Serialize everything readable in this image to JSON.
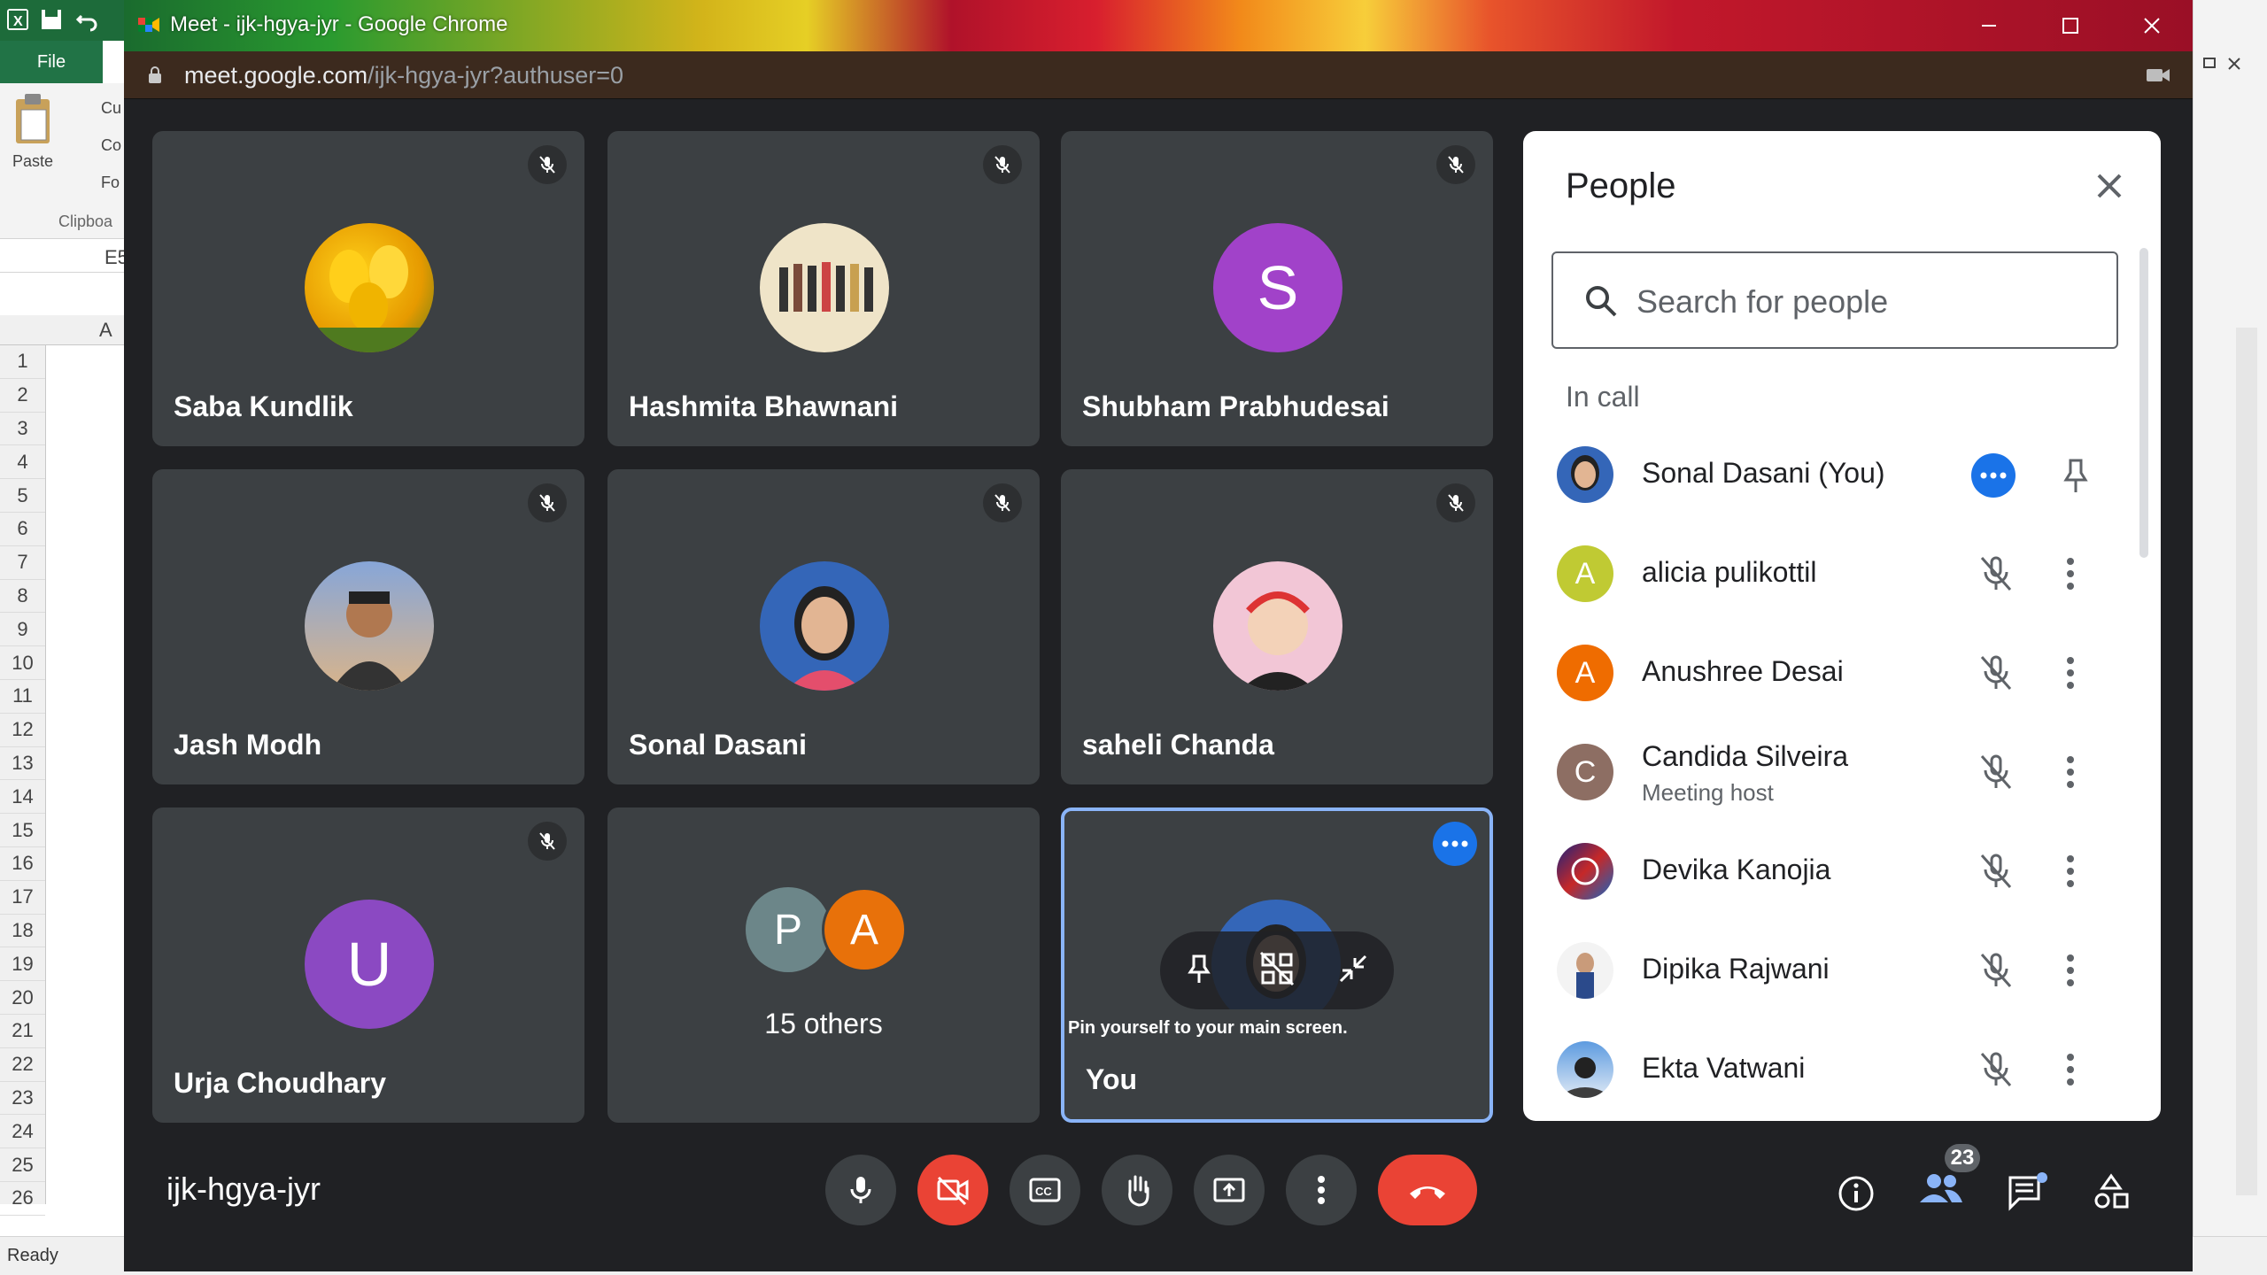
{
  "excel": {
    "file_tab": "File",
    "paste_label": "Paste",
    "cut_label": "Cu",
    "copy_label": "Co",
    "format_label": "Fo",
    "clipboard_group": "Clipboa",
    "name_box": "E5",
    "column_a": "A",
    "row_numbers": [
      "1",
      "2",
      "3",
      "4",
      "5",
      "6",
      "7",
      "8",
      "9",
      "10",
      "11",
      "12",
      "13",
      "14",
      "15",
      "16",
      "17",
      "18",
      "19",
      "20",
      "21",
      "22",
      "23",
      "24",
      "25",
      "26"
    ],
    "status": "Ready"
  },
  "browser": {
    "title": "Meet - ijk-hgya-jyr - Google Chrome",
    "url_host": "meet.google.com",
    "url_path": "/ijk-hgya-jyr?authuser=0"
  },
  "meet": {
    "tiles": [
      {
        "name": "Saba Kundlik",
        "avatar": "photo"
      },
      {
        "name": "Hashmita Bhawnani",
        "avatar": "photo"
      },
      {
        "name": "Shubham Prabhudesai",
        "avatar_letter": "S",
        "avatar_color": "#a142c9"
      },
      {
        "name": "Jash Modh",
        "avatar": "photo"
      },
      {
        "name": "Sonal Dasani",
        "avatar": "photo"
      },
      {
        "name": "saheli Chanda",
        "avatar": "photo"
      },
      {
        "name": "Urja Choudhary",
        "avatar_letter": "U",
        "avatar_color": "#8b49c2"
      },
      {
        "name": "15 others",
        "letters": [
          "P",
          "A"
        ],
        "colors": [
          "#6c8689",
          "#e8710a"
        ]
      },
      {
        "name": "You",
        "avatar": "photo"
      }
    ],
    "tooltip": "Pin yourself to your main screen.",
    "meeting_code": "ijk-hgya-jyr",
    "participant_count": "23"
  },
  "people_panel": {
    "title": "People",
    "search_placeholder": "Search for people",
    "section": "In call",
    "participants": [
      {
        "name": "Sonal Dasani (You)",
        "avatar": "photo"
      },
      {
        "name": "alicia pulikottil",
        "letter": "A",
        "color": "#c0ca33"
      },
      {
        "name": "Anushree Desai",
        "letter": "A",
        "color": "#ef6c00"
      },
      {
        "name": "Candida Silveira",
        "subtitle": "Meeting host",
        "letter": "C",
        "color": "#8d6e63"
      },
      {
        "name": "Devika Kanojia",
        "avatar": "photo"
      },
      {
        "name": "Dipika Rajwani",
        "avatar": "photo"
      },
      {
        "name": "Ekta Vatwani",
        "avatar": "photo"
      }
    ]
  },
  "colors": {
    "meet_bg": "#202124",
    "tile_bg": "#3c4043",
    "end_call": "#ea4335",
    "accent_blue": "#1a73e8",
    "self_border": "#8ab4f8"
  }
}
